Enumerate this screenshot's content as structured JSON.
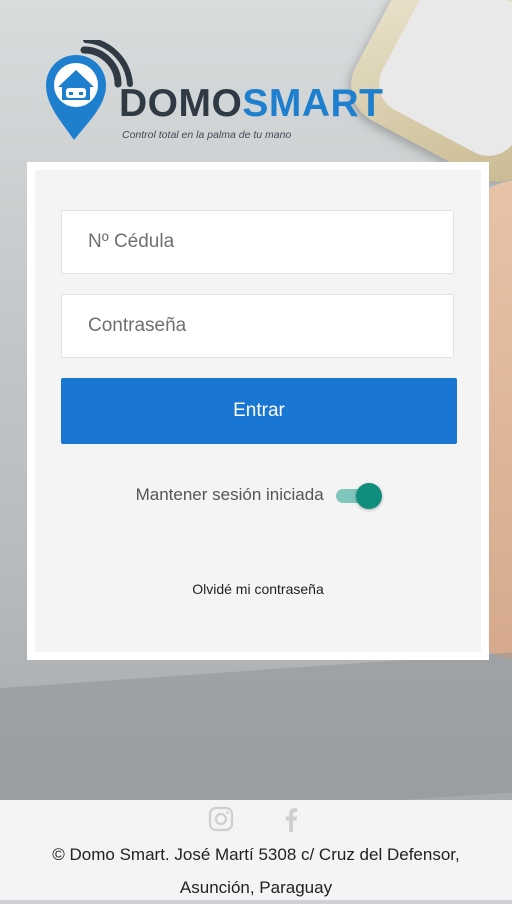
{
  "brand": {
    "name_part1": "DOMO",
    "name_part2": "SMART",
    "tagline": "Control total en la palma de tu mano",
    "logo_icon": "location-pin-house-icon",
    "colors": {
      "dark": "#303a45",
      "blue": "#1e7fcf"
    }
  },
  "login": {
    "cedula_placeholder": "Nº Cédula",
    "password_placeholder": "Contraseña",
    "submit_label": "Entrar",
    "keep_session_label": "Mantener sesión iniciada",
    "keep_session_on": true,
    "forgot_password_label": "Olvidé mi contraseña",
    "colors": {
      "button": "#1976d2",
      "toggle": "#0f8e7e"
    }
  },
  "footer": {
    "social_icons": [
      "instagram-icon",
      "facebook-icon"
    ],
    "address_line1": "© Domo Smart. José Martí 5308 c/ Cruz del Defensor,",
    "address_line2": "Asunción, Paraguay"
  }
}
